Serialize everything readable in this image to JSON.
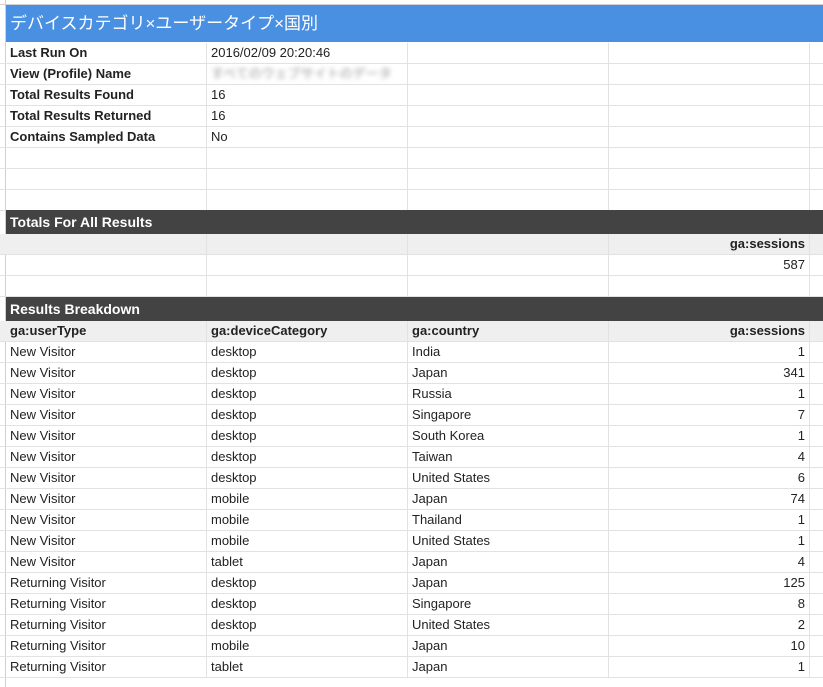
{
  "title": "デバイスカテゴリ×ユーザータイプ×国別",
  "meta": [
    {
      "label": "Last Run On",
      "value": "2016/02/09 20:20:46"
    },
    {
      "label": "View (Profile) Name",
      "value": "すべてのウェブサイトのデータ"
    },
    {
      "label": "Total Results Found",
      "value": "16"
    },
    {
      "label": "Total Results Returned",
      "value": "16"
    },
    {
      "label": "Contains Sampled Data",
      "value": "No"
    }
  ],
  "totals": {
    "heading": "Totals For All Results",
    "column": "ga:sessions",
    "value": "587"
  },
  "breakdown": {
    "heading": "Results Breakdown",
    "columns": [
      "ga:userType",
      "ga:deviceCategory",
      "ga:country",
      "ga:sessions"
    ],
    "rows": [
      [
        "New Visitor",
        "desktop",
        "India",
        "1"
      ],
      [
        "New Visitor",
        "desktop",
        "Japan",
        "341"
      ],
      [
        "New Visitor",
        "desktop",
        "Russia",
        "1"
      ],
      [
        "New Visitor",
        "desktop",
        "Singapore",
        "7"
      ],
      [
        "New Visitor",
        "desktop",
        "South Korea",
        "1"
      ],
      [
        "New Visitor",
        "desktop",
        "Taiwan",
        "4"
      ],
      [
        "New Visitor",
        "desktop",
        "United States",
        "6"
      ],
      [
        "New Visitor",
        "mobile",
        "Japan",
        "74"
      ],
      [
        "New Visitor",
        "mobile",
        "Thailand",
        "1"
      ],
      [
        "New Visitor",
        "mobile",
        "United States",
        "1"
      ],
      [
        "New Visitor",
        "tablet",
        "Japan",
        "4"
      ],
      [
        "Returning Visitor",
        "desktop",
        "Japan",
        "125"
      ],
      [
        "Returning Visitor",
        "desktop",
        "Singapore",
        "8"
      ],
      [
        "Returning Visitor",
        "desktop",
        "United States",
        "2"
      ],
      [
        "Returning Visitor",
        "mobile",
        "Japan",
        "10"
      ],
      [
        "Returning Visitor",
        "tablet",
        "Japan",
        "1"
      ]
    ]
  }
}
